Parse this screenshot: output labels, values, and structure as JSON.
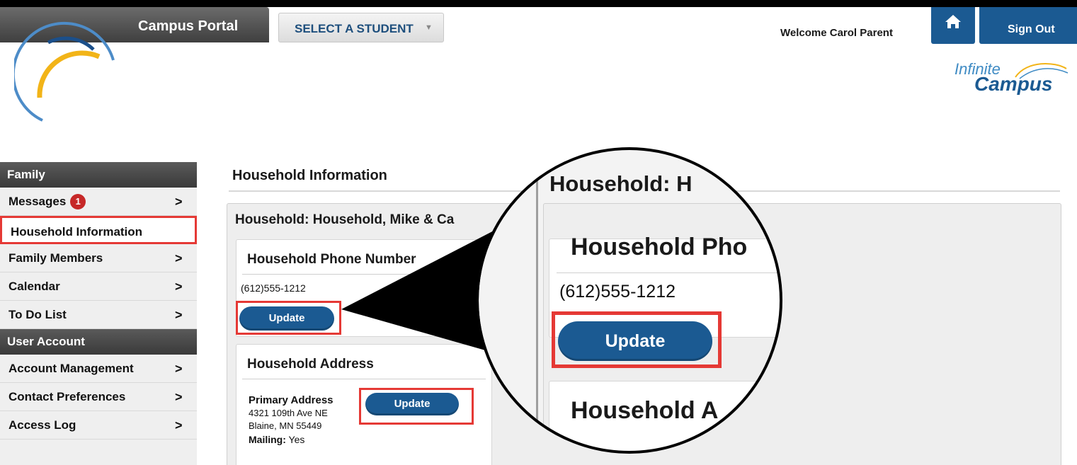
{
  "header": {
    "portal_tab": "Campus Portal",
    "student_select": "SELECT A STUDENT",
    "welcome": "Welcome Carol Parent",
    "signout": "Sign Out",
    "brand_line1": "Infinite",
    "brand_line2": "Campus"
  },
  "sidebar": {
    "family_heading": "Family",
    "family_items": [
      {
        "label": "Messages",
        "badge": "1"
      },
      {
        "label": "Household Information"
      },
      {
        "label": "Family Members"
      },
      {
        "label": "Calendar"
      },
      {
        "label": "To Do List"
      }
    ],
    "account_heading": "User Account",
    "account_items": [
      {
        "label": "Account Management"
      },
      {
        "label": "Contact Preferences"
      },
      {
        "label": "Access Log"
      }
    ],
    "chevron": ">"
  },
  "main": {
    "title": "Household Information",
    "household_title": "Household: Household, Mike & Ca",
    "phone_card": {
      "title": "Household Phone Number",
      "phone": "(612)555-1212",
      "update": "Update"
    },
    "address_card": {
      "title": "Household Address",
      "address_label": "Primary Address",
      "line1": "4321 109th Ave NE",
      "line2": "Blaine, MN 55449",
      "mailing_label": "Mailing:",
      "mailing_value": "Yes",
      "update": "Update"
    }
  },
  "zoom": {
    "household": "Household: H",
    "phone_title": "Household Pho",
    "phone": "(612)555-1212",
    "update": "Update",
    "address_title": "Household A"
  }
}
